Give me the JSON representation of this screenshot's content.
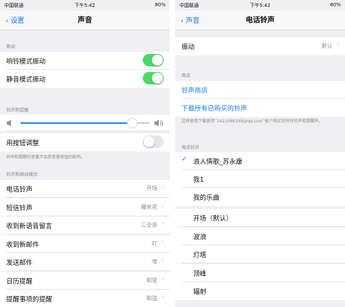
{
  "left": {
    "status": {
      "carrier": "中国联通",
      "time": "下午5:42",
      "battery": "80%"
    },
    "nav": {
      "back": "设置",
      "title": "声音"
    },
    "vibrate_header": "振动",
    "vibrate_ring": {
      "label": "响铃模式振动",
      "on": true
    },
    "vibrate_silent": {
      "label": "静音模式振动",
      "on": true
    },
    "volume_header": "铃声和提醒",
    "volume_level": 0.87,
    "change_with_buttons": {
      "label": "用按钮调整",
      "on": false
    },
    "volume_note": "铃声和提醒的音量不会受音量按钮的影响。",
    "patterns_header": "铃声和振动模式",
    "patterns": [
      {
        "label": "电话铃声",
        "value": "开场"
      },
      {
        "label": "短信铃声",
        "value": "爆米花"
      },
      {
        "label": "收到新语音留言",
        "value": "三全音"
      },
      {
        "label": "收到新邮件",
        "value": "叮"
      },
      {
        "label": "发送邮件",
        "value": "嗖"
      },
      {
        "label": "日历提醒",
        "value": "和弦"
      },
      {
        "label": "提醒事项的提醒",
        "value": "和弦"
      }
    ]
  },
  "right": {
    "status": {
      "carrier": "中国联通",
      "time": "下午5:42",
      "battery": "80%"
    },
    "nav": {
      "back": "声音",
      "title": "电话铃声"
    },
    "vibration": {
      "label": "振动",
      "value": "默认"
    },
    "store_header": "商店",
    "store_link": "铃声商店",
    "download_link": "下载所有已购买的铃声",
    "store_note": "这将使用下载使用“1421088348@qq.com”帐户购买的所有铃声和提醒声。",
    "tones_header": "电话铃声",
    "selected_tone": "浪人情歌_苏永康",
    "custom_tones": [
      "我1",
      "我的乐曲"
    ],
    "builtin_tones": [
      "开场（默认）",
      "波浪",
      "灯塔",
      "顶峰",
      "辐射"
    ]
  }
}
